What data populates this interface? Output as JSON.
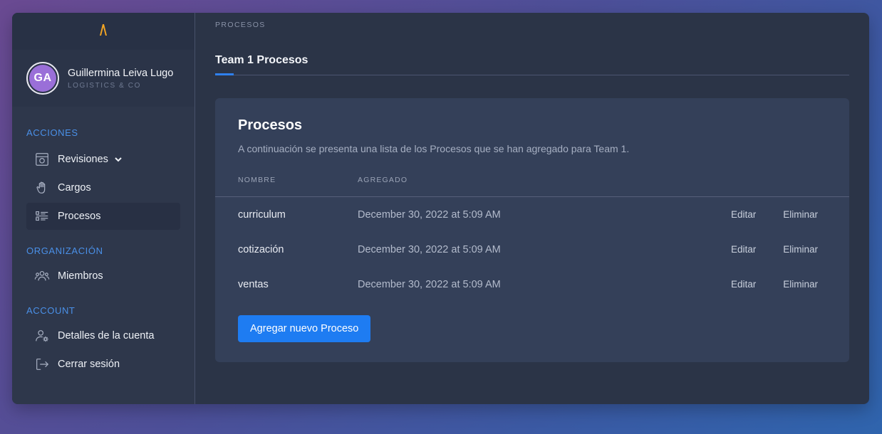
{
  "profile": {
    "initials": "GA",
    "name": "Guillermina Leiva Lugo",
    "org": "LOGISTICS & CO"
  },
  "sidebar": {
    "sections": [
      {
        "label": "ACCIONES"
      },
      {
        "label": "ORGANIZACIÓN"
      },
      {
        "label": "ACCOUNT"
      }
    ],
    "items": [
      {
        "label": "Revisiones",
        "icon": "box-icon"
      },
      {
        "label": "Cargos",
        "icon": "hand-icon"
      },
      {
        "label": "Procesos",
        "icon": "list-icon"
      },
      {
        "label": "Miembros",
        "icon": "users-icon"
      },
      {
        "label": "Detalles de la cuenta",
        "icon": "user-settings-icon"
      },
      {
        "label": "Cerrar sesión",
        "icon": "logout-icon"
      }
    ]
  },
  "breadcrumb": "PROCESOS",
  "tab": {
    "label": "Team 1 Procesos"
  },
  "card": {
    "title": "Procesos",
    "description": "A continuación se presenta una lista de los Procesos que se han agregado para Team 1.",
    "columns": {
      "name": "NOMBRE",
      "added": "AGREGADO"
    },
    "rows": [
      {
        "name": "curriculum",
        "added": "December 30, 2022 at 5:09 AM",
        "edit": "Editar",
        "delete": "Eliminar"
      },
      {
        "name": "cotización",
        "added": "December 30, 2022 at 5:09 AM",
        "edit": "Editar",
        "delete": "Eliminar"
      },
      {
        "name": "ventas",
        "added": "December 30, 2022 at 5:09 AM",
        "edit": "Editar",
        "delete": "Eliminar"
      }
    ],
    "add_button": "Agregar nuevo Proceso"
  },
  "colors": {
    "accent": "#1e7cf2",
    "section_label": "#4a90e8",
    "logo": "#f5a623",
    "avatar": "#9a6fd8"
  }
}
